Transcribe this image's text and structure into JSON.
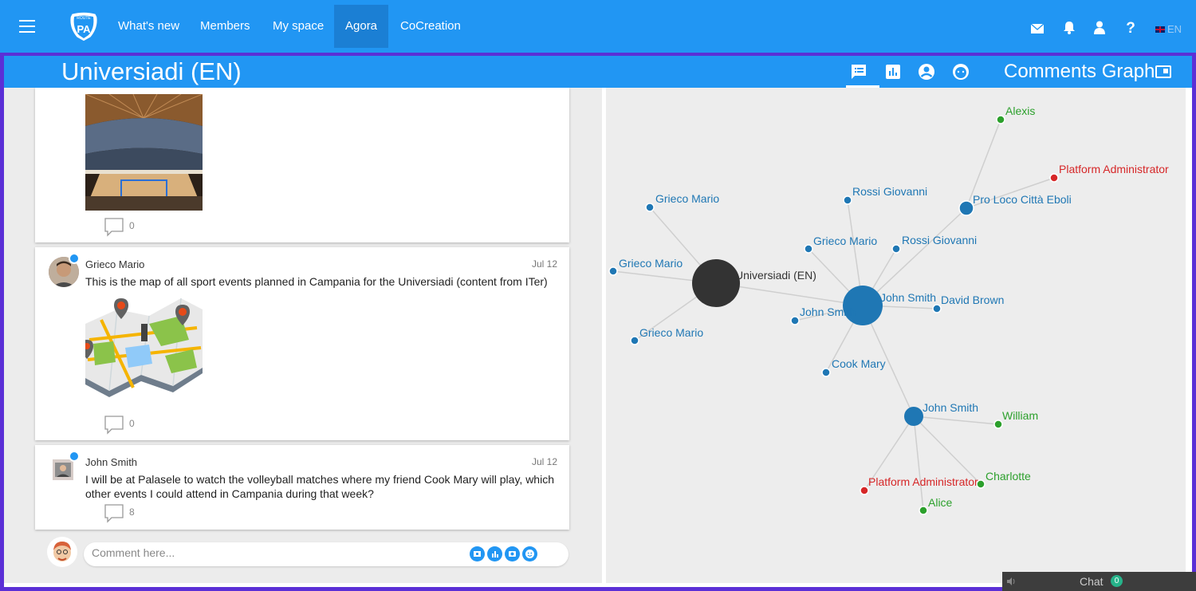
{
  "nav": {
    "items": [
      {
        "label": "What's new"
      },
      {
        "label": "Members"
      },
      {
        "label": "My space"
      },
      {
        "label": "Agora"
      },
      {
        "label": "CoCreation"
      }
    ],
    "logo_text_top": "ROUTE",
    "logo_text_main": "PA",
    "lang": "EN"
  },
  "subheader": {
    "title": "Universiadi (EN)",
    "graph_title": "Comments Graph"
  },
  "posts": [
    {
      "comments": "0"
    },
    {
      "author": "Grieco Mario",
      "date": "Jul 12",
      "text": "This is the map of all sport events planned in Campania for the Universiadi (content from ITer)",
      "comments": "0"
    },
    {
      "author": "John Smith",
      "date": "Jul 12",
      "text": "I will be at Palasele to watch the volleyball matches where my friend Cook Mary will play, which other events I could attend in Campania during that week?",
      "comments": "8"
    }
  ],
  "comment_box": {
    "placeholder": "Comment here..."
  },
  "graph": {
    "colors": {
      "hub": "#333333",
      "blue": "#1f77b4",
      "green": "#2ca02c",
      "red": "#d62728",
      "edge": "#cfcfcf"
    },
    "labels": {
      "universiadi": "Universiadi (EN)",
      "grieco1": "Grieco Mario",
      "grieco2": "Grieco Mario",
      "grieco3": "Grieco Mario",
      "grieco4": "Grieco Mario",
      "rossi1": "Rossi Giovanni",
      "rossi2": "Rossi Giovanni",
      "johnsmith_main": "John Smith",
      "johnsmith_small": "John Smith",
      "johnsmith_lower": "John Smith",
      "david": "David Brown",
      "cook": "Cook Mary",
      "proloco": "Pro Loco Città Eboli",
      "alexis": "Alexis",
      "admin1": "Platform Administrator",
      "admin2": "Platform Administrator",
      "william": "William",
      "charlotte": "Charlotte",
      "alice": "Alice"
    }
  },
  "chat": {
    "label": "Chat",
    "count": "0"
  }
}
